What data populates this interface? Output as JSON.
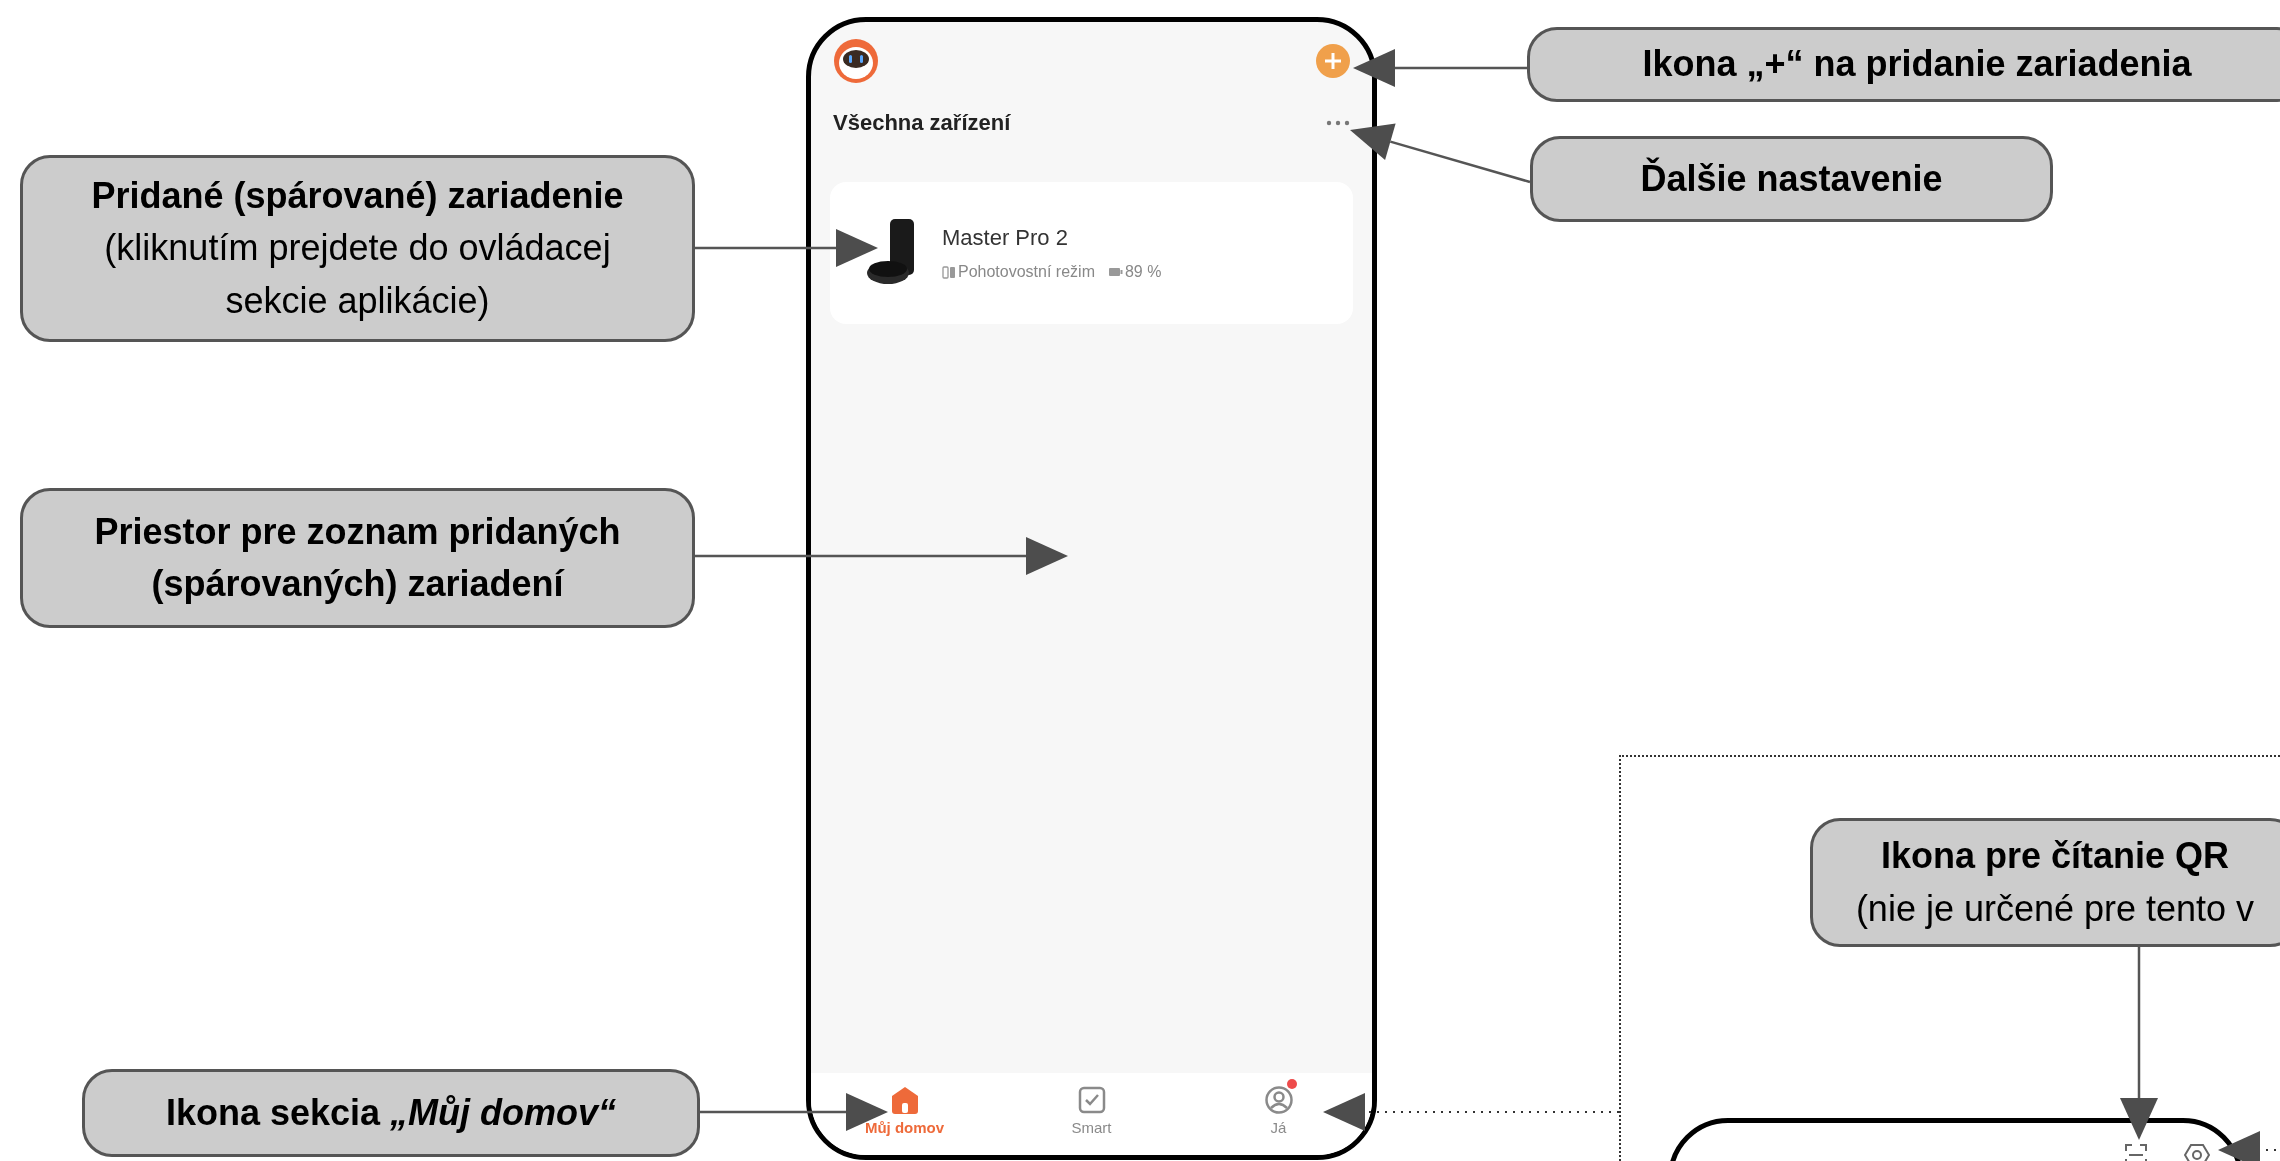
{
  "phone": {
    "title": "Všechna zařízení",
    "devices": [
      {
        "name": "Master Pro 2",
        "status": "Pohotovostní režim",
        "battery": "89 %"
      }
    ],
    "tabs": [
      {
        "label": "Můj domov",
        "kind": "home",
        "selected": true,
        "badge": false
      },
      {
        "label": "Smart",
        "kind": "check",
        "selected": false,
        "badge": false
      },
      {
        "label": "Já",
        "kind": "person",
        "selected": false,
        "badge": true
      }
    ]
  },
  "callouts": [
    {
      "title": "Pridané (spárované) zariadenie",
      "note": "(kliknutím prejdete do ovládacej sekcie aplikácie)"
    },
    {
      "title": "Priestor pre zoznam pridaných (spárovaných) zariadení"
    },
    {
      "title": "Ikona sekcia *„Můj domov“*"
    },
    {
      "title": "Ikona „+“ na pridanie zariadenia"
    },
    {
      "title": "Ďalšie nastavenie"
    },
    {
      "title": "Ikona pre čítanie QR",
      "note": "(nie je určené pre tento v"
    }
  ]
}
